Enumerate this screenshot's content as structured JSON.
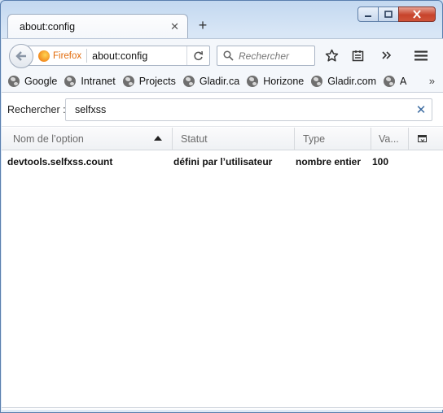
{
  "window": {
    "controls": [
      "minimize-icon",
      "maximize-icon",
      "close-icon"
    ]
  },
  "tab": {
    "title": "about:config",
    "close_glyph": "✕",
    "new_tab_glyph": "+"
  },
  "navbar": {
    "identity_label": "Firefox",
    "url": "about:config",
    "search_placeholder": "Rechercher",
    "icons": [
      "back-arrow-icon",
      "firefox-icon",
      "reload-icon",
      "search-icon",
      "star-icon",
      "reading-list-icon",
      "overflow-chevron-icon",
      "hamburger-menu-icon"
    ]
  },
  "bookmarks": {
    "items": [
      {
        "label": "Google"
      },
      {
        "label": "Intranet"
      },
      {
        "label": "Projects"
      },
      {
        "label": "Gladir.ca"
      },
      {
        "label": "Horizone"
      },
      {
        "label": "Gladir.com"
      },
      {
        "label": "A"
      }
    ],
    "more_glyph": "»"
  },
  "config": {
    "filter_label": "Rechercher :",
    "filter_value": "selfxss",
    "clear_glyph": "✕",
    "columns": {
      "name": "Nom de l’option",
      "status": "Statut",
      "type": "Type",
      "value": "Va..."
    },
    "sort": "name-descending",
    "rows": [
      {
        "name": "devtools.selfxss.count",
        "status": "défini par l’utilisateur",
        "type": "nombre entier",
        "value": "100"
      }
    ]
  },
  "colors": {
    "frame": "#c3d8f0",
    "close_button": "#c7432b",
    "firefox_orange": "#e26b0a",
    "clear_icon": "#3a6aa0"
  }
}
